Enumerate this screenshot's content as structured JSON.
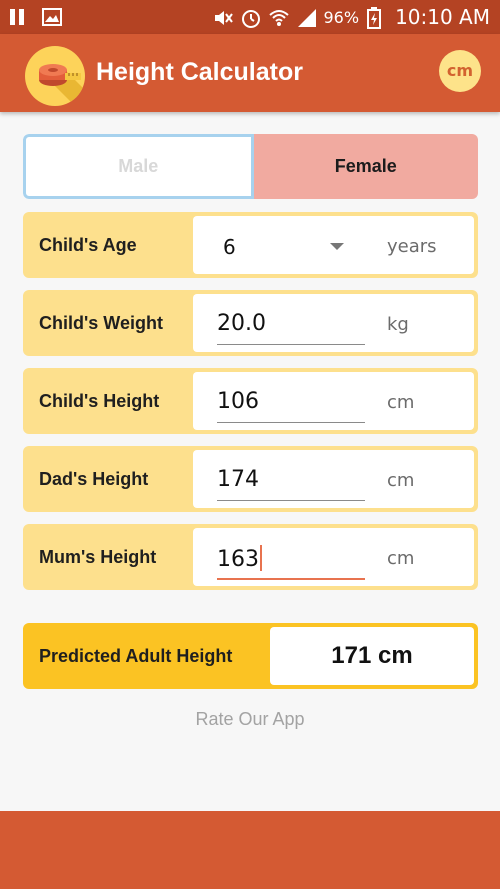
{
  "status_bar": {
    "battery": "96%",
    "time": "10:10 AM",
    "icons": [
      "pause-icon",
      "image-icon",
      "mute-icon",
      "alarm-icon",
      "wifi-icon",
      "signal-icon",
      "battery-charging-icon"
    ]
  },
  "app_bar": {
    "title": "Height Calculator",
    "unit_toggle": "cm",
    "logo_icon": "measuring-tape-icon",
    "color": "#d45a33"
  },
  "gender": {
    "male_label": "Male",
    "female_label": "Female",
    "selected": "Female"
  },
  "fields": {
    "age": {
      "label": "Child's Age",
      "value": "6",
      "unit": "years"
    },
    "weight": {
      "label": "Child's Weight",
      "value": "20.0",
      "unit": "kg"
    },
    "child_height": {
      "label": "Child's Height",
      "value": "106",
      "unit": "cm"
    },
    "dad_height": {
      "label": "Dad's Height",
      "value": "174",
      "unit": "cm"
    },
    "mum_height": {
      "label": "Mum's Height",
      "value": "163",
      "unit": "cm"
    }
  },
  "result": {
    "label": "Predicted Adult Height",
    "value": "171 cm"
  },
  "rate_link": "Rate Our App",
  "colors": {
    "accent": "#d45a33",
    "field_label_bg": "#fde08d",
    "result_bg": "#fbc323",
    "female_selected": "#f1aaa0",
    "active_underline": "#e8734f"
  }
}
